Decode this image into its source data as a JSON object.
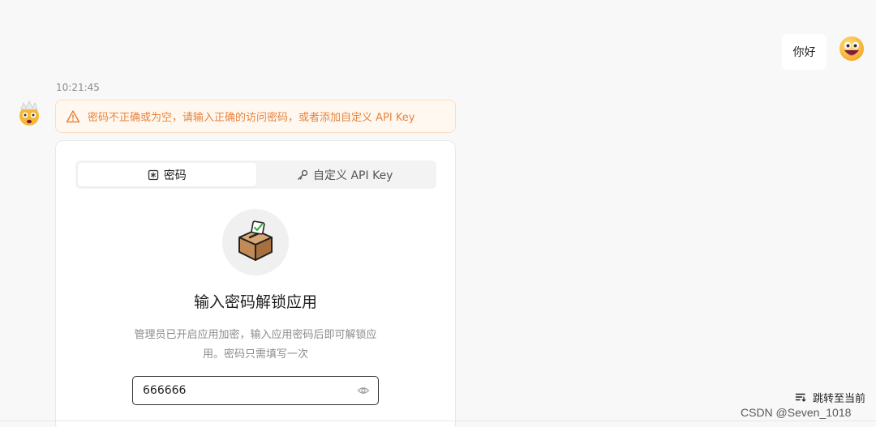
{
  "user_message": {
    "text": "你好",
    "avatar_icon": "grinning-face-emoji"
  },
  "assistant": {
    "avatar_icon": "exploding-head-emoji",
    "timestamp": "10:21:45",
    "alert": {
      "icon": "warning-triangle-icon",
      "text": "密码不正确或为空，请输入正确的访问密码，或者添加自定义 API Key",
      "color": "#e8833a"
    },
    "auth_card": {
      "tabs": [
        {
          "label": "密码",
          "icon": "asterisk-box-icon",
          "active": true
        },
        {
          "label": "自定义 API Key",
          "icon": "key-icon",
          "active": false
        }
      ],
      "illustration": "ballot-box-check-icon",
      "title": "输入密码解锁应用",
      "description": "管理员已开启应用加密，输入应用密码后即可解锁应用。密码只需填写一次",
      "password_input": {
        "value": "666666",
        "placeholder": "",
        "icon": "eye-icon"
      }
    }
  },
  "jump_to_current": {
    "label": "跳转至当前",
    "icon": "list-jump-icon"
  },
  "watermark": "CSDN @Seven_1018"
}
